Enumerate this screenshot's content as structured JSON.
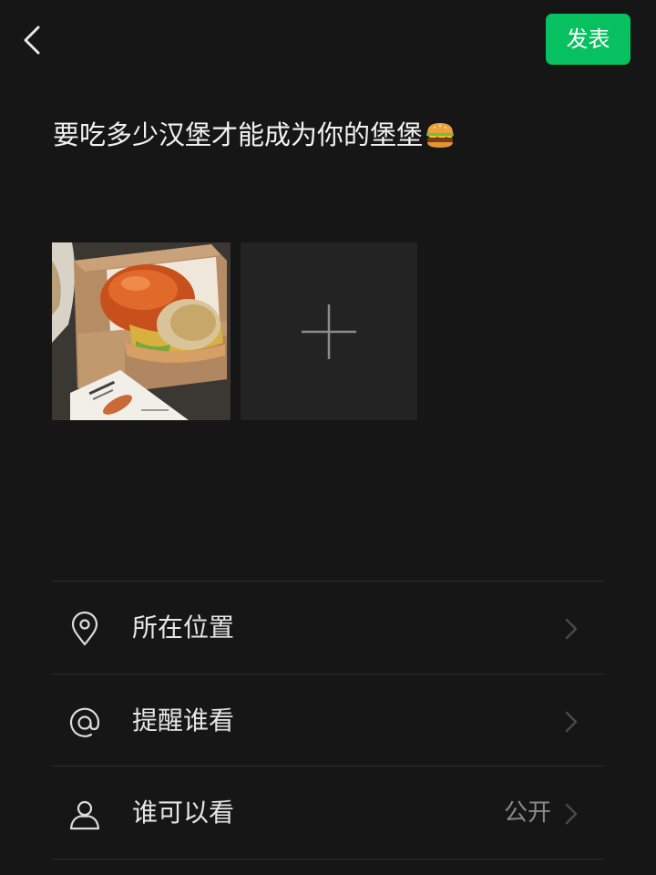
{
  "topbar": {
    "back_icon": "chevron-left-icon",
    "publish_label": "发表",
    "accent_color": "#07c160"
  },
  "post": {
    "text": "要吃多少汉堡才能成为你的堡堡",
    "emoji_icon": "burger-emoji-icon"
  },
  "media": {
    "photos": [
      {
        "description_icon": "burger-photo"
      }
    ],
    "add_icon": "plus-icon"
  },
  "options": [
    {
      "icon": "location-pin-icon",
      "label": "所在位置",
      "value": ""
    },
    {
      "icon": "at-sign-icon",
      "label": "提醒谁看",
      "value": ""
    },
    {
      "icon": "person-icon",
      "label": "谁可以看",
      "value": "公开"
    }
  ]
}
